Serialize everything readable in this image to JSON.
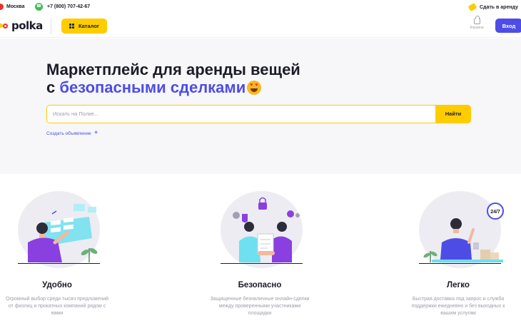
{
  "topbar": {
    "city": "Москва",
    "phone": "+7 (800) 707-42-67",
    "rent_out": "Сдать в аренду"
  },
  "header": {
    "logo": "polka",
    "catalog": "Каталог",
    "cart": "Корзина",
    "login": "Вход"
  },
  "hero": {
    "title_line1": "Маркетплейс для аренды вещей",
    "title_prefix": "с ",
    "title_accent": "безопасными сделками",
    "search_placeholder": "Искать на Полке...",
    "search_button": "Найти",
    "create_listing": "Создать объявление"
  },
  "features": [
    {
      "title": "Удобно",
      "desc": "Огромный выбор среди тысяч предложений от физлиц и прокатных компаний рядом с вами"
    },
    {
      "title": "Безопасно",
      "desc": "Защищенные безналичные онлайн-сделки между проверенными участниками площадки"
    },
    {
      "title": "Легко",
      "desc": "Быстрая доставка под запрос и служба поддержки ежедневно и без выходных к вашим услугам",
      "badge": "24/7"
    }
  ],
  "colors": {
    "accent": "#4d4de6",
    "brand_yellow": "#ffcc00",
    "purple": "#8a3fe0"
  }
}
